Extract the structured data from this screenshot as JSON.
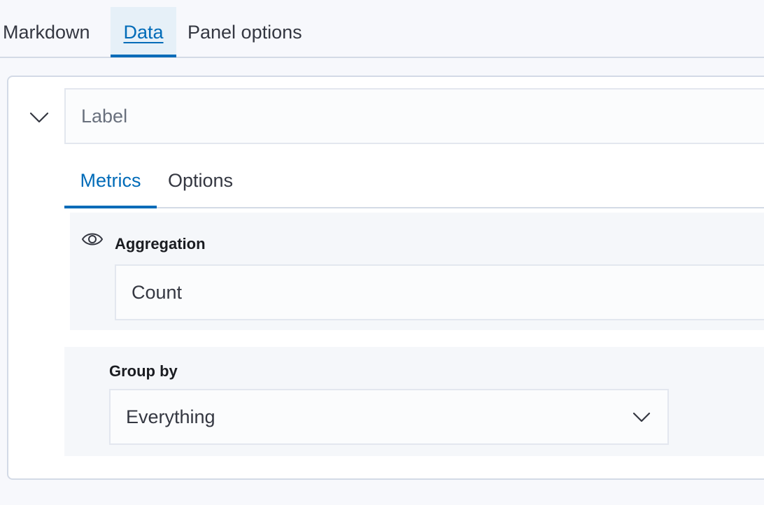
{
  "top_tabs": {
    "markdown": "Markdown",
    "data": "Data",
    "panel_options": "Panel options"
  },
  "series": {
    "label_placeholder": "Label",
    "label_value": "",
    "inner_tabs": {
      "metrics": "Metrics",
      "options": "Options"
    },
    "aggregation": {
      "label": "Aggregation",
      "value": "Count"
    },
    "group_by": {
      "label": "Group by",
      "value": "Everything"
    }
  },
  "icons": {
    "collapse": "chevron-down-icon",
    "visibility": "eye-icon",
    "group_dropdown": "chevron-down-icon"
  },
  "colors": {
    "accent": "#006bb8",
    "active_tab_bg": "#e6f0f8",
    "border": "#d3dae6",
    "text": "#343741"
  }
}
